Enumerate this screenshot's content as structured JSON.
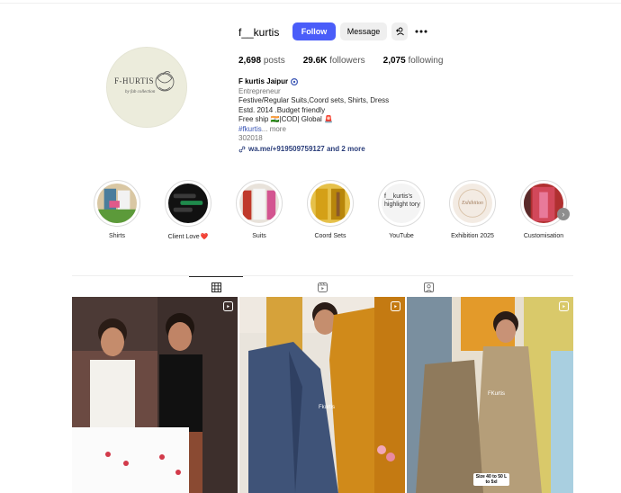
{
  "profile": {
    "username": "f__kurtis",
    "follow_label": "Follow",
    "message_label": "Message",
    "avatar": {
      "brand_text": "F-HURTIS",
      "sub_text": "by fab collection"
    },
    "stats": [
      {
        "value": "2,698",
        "label": "posts"
      },
      {
        "value": "29.6K",
        "label": "followers"
      },
      {
        "value": "2,075",
        "label": "following"
      }
    ],
    "bio": {
      "name": "F kurtis Jaipur",
      "category": "Entrepreneur",
      "line1": "Festive/Regular Suits,Coord sets, Shirts, Dress",
      "line2": "Estd. 2014 .Budget friendly",
      "line3": "Free ship 🇮🇳|COD| Global 🚨",
      "hashtag": "#fkurtis",
      "more": "... more",
      "code": "302018",
      "link": "wa.me/+919509759127 and 2 more"
    }
  },
  "highlights": [
    {
      "label": "Shirts"
    },
    {
      "label": "Client Love",
      "suffix": "❤️"
    },
    {
      "label": "Suits"
    },
    {
      "label": "Coord Sets"
    },
    {
      "label": "YouTube",
      "cover_text": "f__kurtis's highlight tory"
    },
    {
      "label": "Exhibition 2025",
      "cover_text": "Exhibition"
    },
    {
      "label": "Customisation"
    }
  ],
  "tabs": [
    "posts-grid",
    "reels",
    "tagged"
  ],
  "posts": [
    {
      "watermark": ""
    },
    {
      "watermark": "Fkurtis"
    },
    {
      "watermark": "FKurtis",
      "badge": "Size 40 to 50 L to 5xl"
    }
  ],
  "colors": {
    "follow_button": "#4a5df9",
    "link": "#2a3d7a",
    "hashtag": "#3b56b5",
    "heart": "#e0245e"
  }
}
